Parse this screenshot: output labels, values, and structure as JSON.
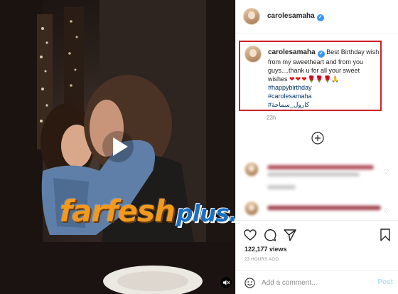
{
  "media": {
    "watermark_main": "farfesh",
    "watermark_sub": "plus.com",
    "watermark_colors": {
      "main": "#f19a1d",
      "sub": "#1b6fc2"
    },
    "play_icon": "play-icon",
    "mute_icon": "speaker-muted-icon"
  },
  "header": {
    "username": "carolesamaha",
    "verified_icon": "verified-badge-icon"
  },
  "caption": {
    "username": "carolesamaha",
    "text": "Best Birthday wish from my sweetheart and from you guys....thank u for all your sweet wishes",
    "hearts": "❤❤❤",
    "roses": "🌹🌹🌹",
    "hands": "🙏",
    "hashtags": [
      "#happybirthday",
      "#carolesamaha",
      "#كارول_سماحة"
    ],
    "time_ago": "23h",
    "highlight_color": "#d0202a"
  },
  "load_more_icon": "plus-circle-icon",
  "footer": {
    "views": "122,177 views",
    "posted_time": "23 HOURS AGO",
    "comment_placeholder": "Add a comment...",
    "post_label": "Post"
  }
}
